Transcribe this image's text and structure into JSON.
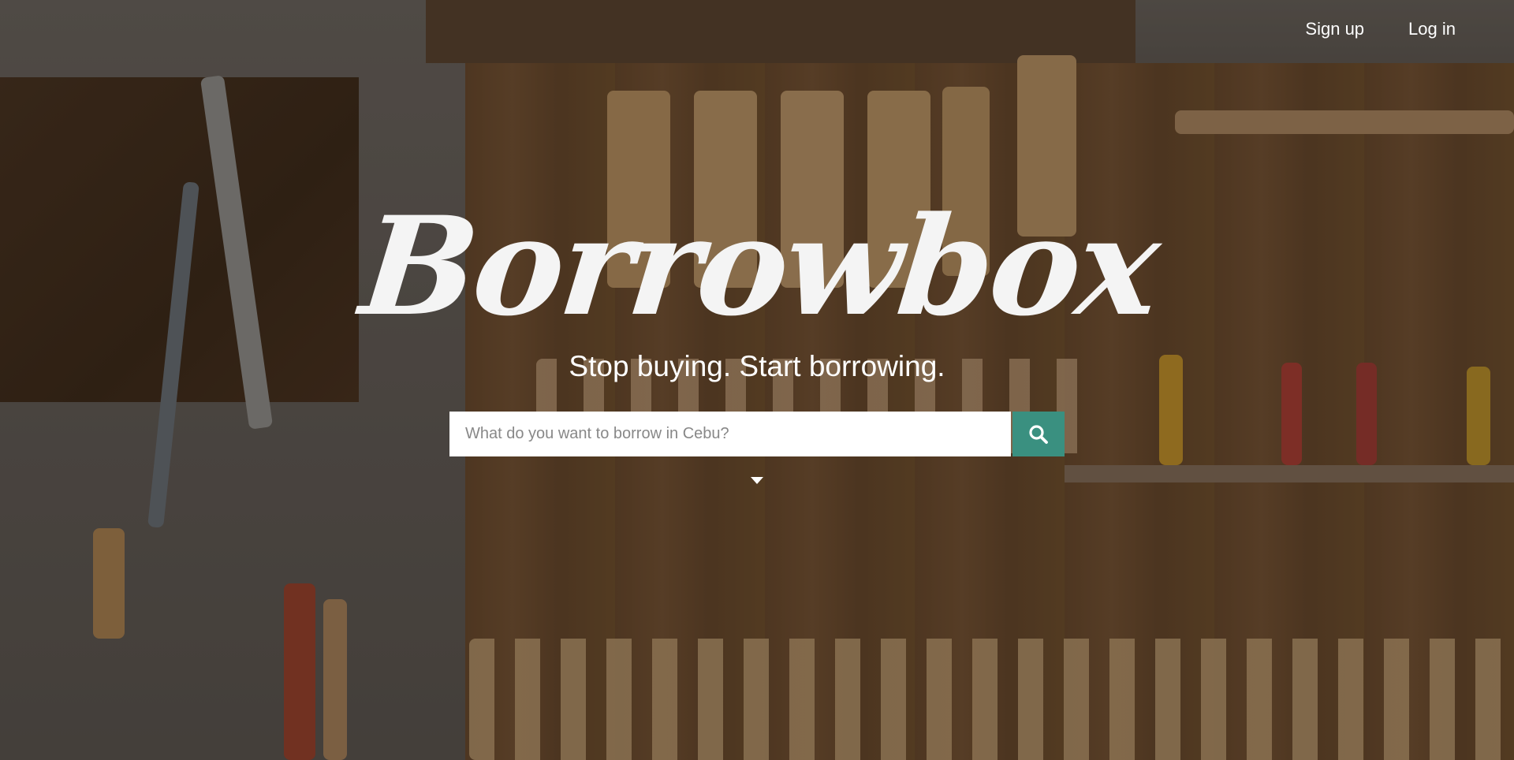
{
  "nav": {
    "signup_label": "Sign up",
    "login_label": "Log in"
  },
  "hero": {
    "logo_text": "Borrowbox",
    "tagline": "Stop buying. Start borrowing."
  },
  "search": {
    "placeholder": "What do you want to borrow in Cebu?",
    "value": "",
    "button_icon": "search-icon",
    "button_color": "#3a9080"
  },
  "scroll_indicator_icon": "caret-down-icon"
}
